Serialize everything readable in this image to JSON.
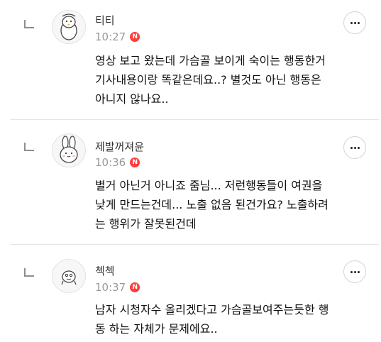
{
  "comments": [
    {
      "nickname": "티티",
      "time": "10:27",
      "new_badge": "N",
      "lines": [
        "영상 보고 왔는데 가슴골 보이게 숙이는 행동한거",
        "기사내용이랑 똑같은데요..? 별것도 아닌 행동은",
        "아니지 않나요.."
      ],
      "avatar_icon": "penguin-avatar-icon"
    },
    {
      "nickname": "제발꺼져윤",
      "time": "10:36",
      "new_badge": "N",
      "lines": [
        "별거 아닌거 아니죠 줌님... 저런행동들이 여권을",
        "낮게 만드는건데... 노출 없음 된건가요? 노출하려",
        "는 행위가 잘못된건데"
      ],
      "avatar_icon": "bunny-avatar-icon"
    },
    {
      "nickname": "첵첵",
      "time": "10:37",
      "new_badge": "N",
      "lines": [
        "남자 시청자수 올리겠다고 가슴골보여주는듯한 행",
        "동 하는 자체가 문제에요.."
      ],
      "avatar_icon": "face-avatar-icon"
    }
  ],
  "colors": {
    "badge": "#ff3d3d",
    "meta": "#9a9a9a",
    "divider": "#e6e6e6"
  }
}
